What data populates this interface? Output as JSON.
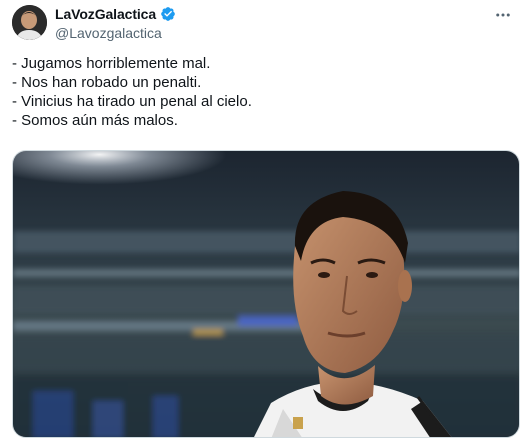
{
  "author": {
    "display_name": "LaVozGalactica",
    "handle": "@Lavozgalactica",
    "verified": true,
    "verified_color": "#1d9bf0"
  },
  "more_icon": "more-horizontal-icon",
  "tweet_lines": [
    "- Jugamos horriblemente mal.",
    "- Nos han robado un penalti.",
    "- Vinicius ha tirado un penal al cielo.",
    "- Somos aún más malos."
  ],
  "colors": {
    "text_primary": "#0f1419",
    "text_secondary": "#536471",
    "border": "#cfd9de"
  }
}
